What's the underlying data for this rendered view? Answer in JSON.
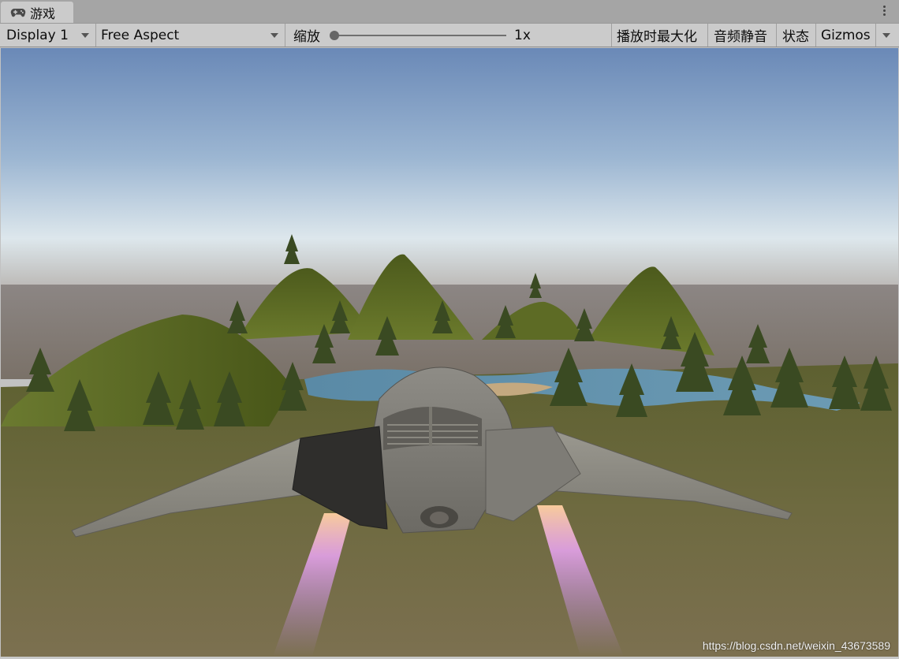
{
  "tab": {
    "title": "游戏",
    "icon": "gamepad-icon"
  },
  "toolbar": {
    "display": "Display 1",
    "aspect": "Free Aspect",
    "scale_label": "缩放",
    "scale_value": "1x",
    "maximize_on_play": "播放时最大化",
    "mute_audio": "音频静音",
    "stats": "状态",
    "gizmos": "Gizmos"
  },
  "viewport": {
    "watermark": "https://blog.csdn.net/weixin_43673589",
    "sky_top_color": "#6f8fbd",
    "horizon_color": "#dfe8ee",
    "ground_color": "#6b6a3f"
  }
}
